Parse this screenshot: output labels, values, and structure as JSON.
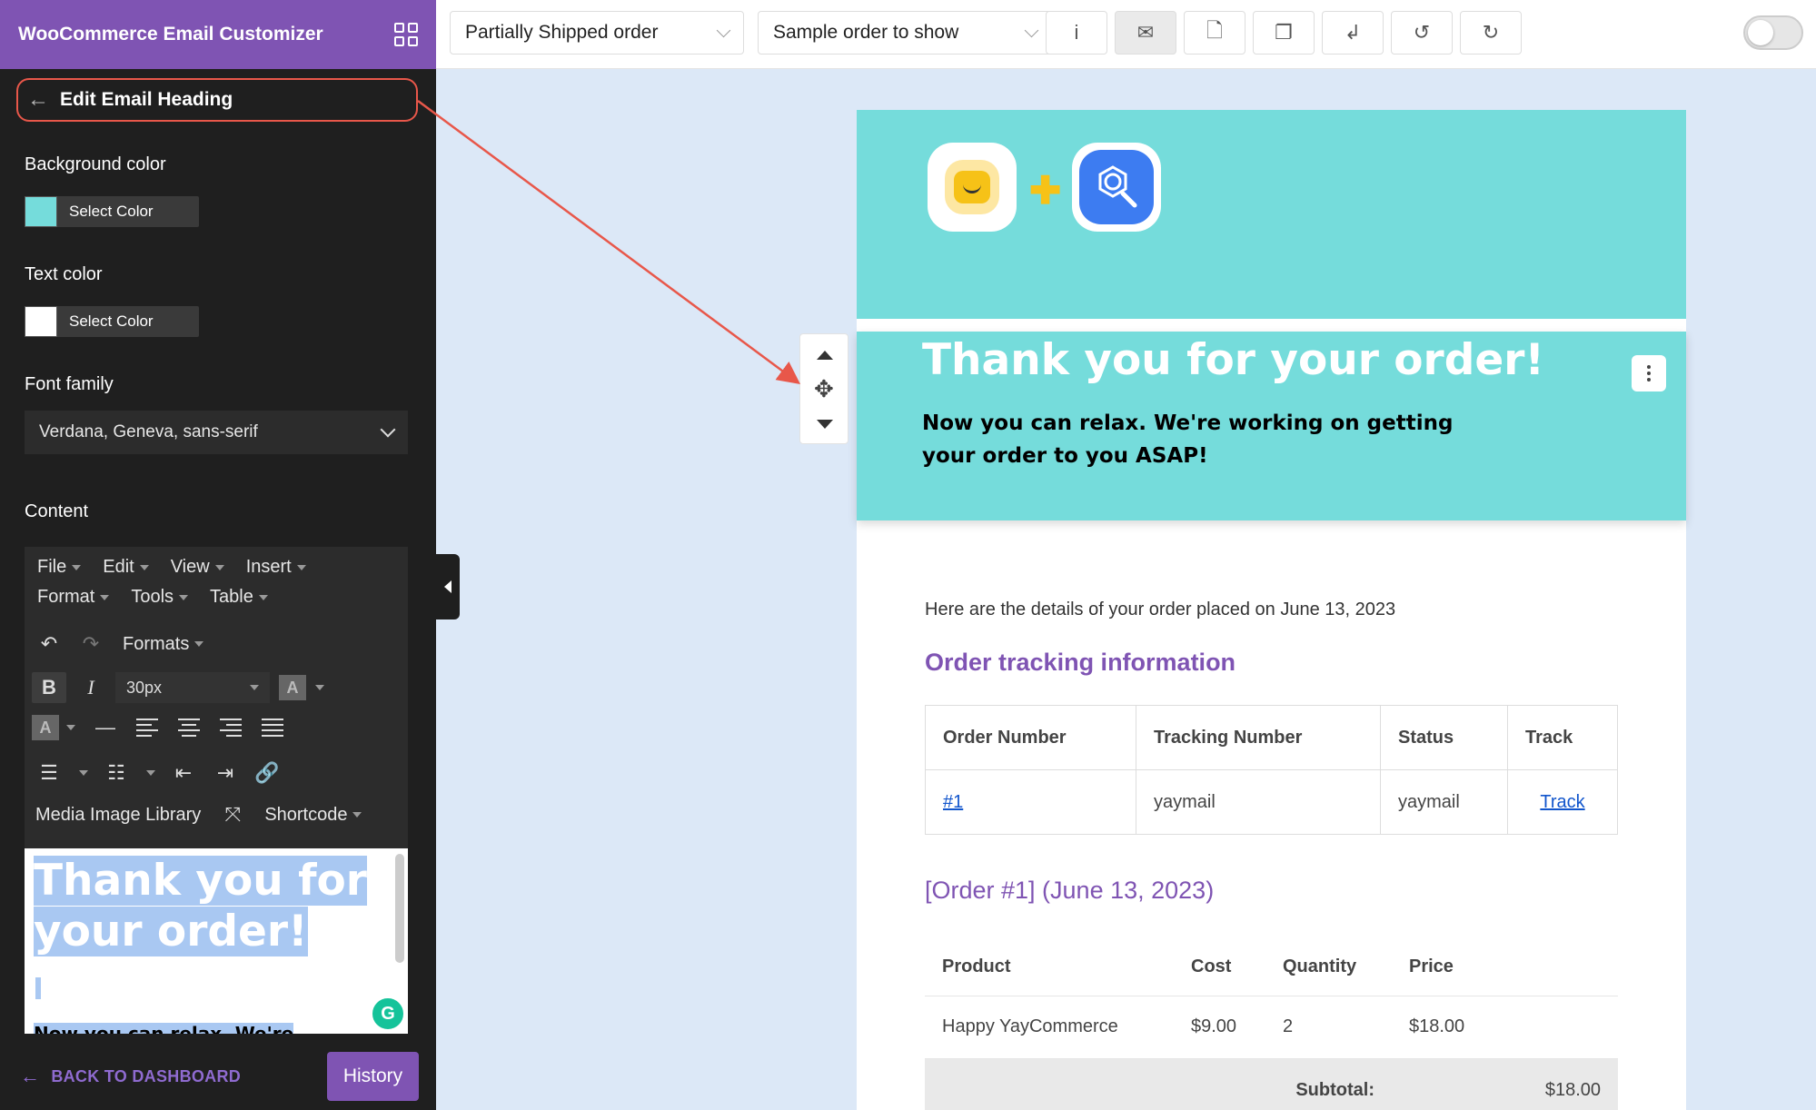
{
  "sidebar": {
    "app_title": "WooCommerce Email Customizer",
    "edit_heading": "Edit Email Heading",
    "background_color_label": "Background color",
    "background_color_value": "#75dcdb",
    "background_select": "Select Color",
    "text_color_label": "Text color",
    "text_color_value": "#ffffff",
    "text_select": "Select Color",
    "font_family_label": "Font family",
    "font_family_value": "Verdana, Geneva, sans-serif",
    "content_label": "Content",
    "menu": [
      "File",
      "Edit",
      "View",
      "Insert",
      "Format",
      "Tools",
      "Table"
    ],
    "formats_label": "Formats",
    "font_size": "30px",
    "media_library": "Media Image Library",
    "shortcode": "Shortcode",
    "content_heading": "Thank you for your order!",
    "content_para": "Now you can relax. We're",
    "back_to_dashboard": "BACK TO DASHBOARD",
    "history": "History"
  },
  "topbar": {
    "email_type": "Partially Shipped order",
    "sample_order": "Sample order to show",
    "info_icon": "i"
  },
  "email": {
    "heading_title": "Thank you for your order!",
    "heading_subtitle": "Now you can relax. We're working on getting your order to you ASAP!",
    "order_intro": "Here are the details of your order placed on June 13, 2023",
    "tracking_title": "Order tracking information",
    "tracking_headers": [
      "Order Number",
      "Tracking Number",
      "Status",
      "Track"
    ],
    "tracking_row": {
      "order": "#1",
      "tracking": "yaymail",
      "status": "yaymail",
      "track": "Track"
    },
    "order_title": "[Order #1] (June 13, 2023)",
    "item_headers": [
      "Product",
      "Cost",
      "Quantity",
      "Price"
    ],
    "item_row": {
      "product": "Happy YayCommerce",
      "cost": "$9.00",
      "quantity": "2",
      "price": "$18.00"
    },
    "subtotal_label": "Subtotal:",
    "subtotal_value": "$18.00"
  },
  "colors": {
    "brand_purple": "#7f54b3",
    "email_teal": "#75dcdb",
    "canvas_bg": "#dce8f7",
    "annotation_red": "#e8574a"
  }
}
